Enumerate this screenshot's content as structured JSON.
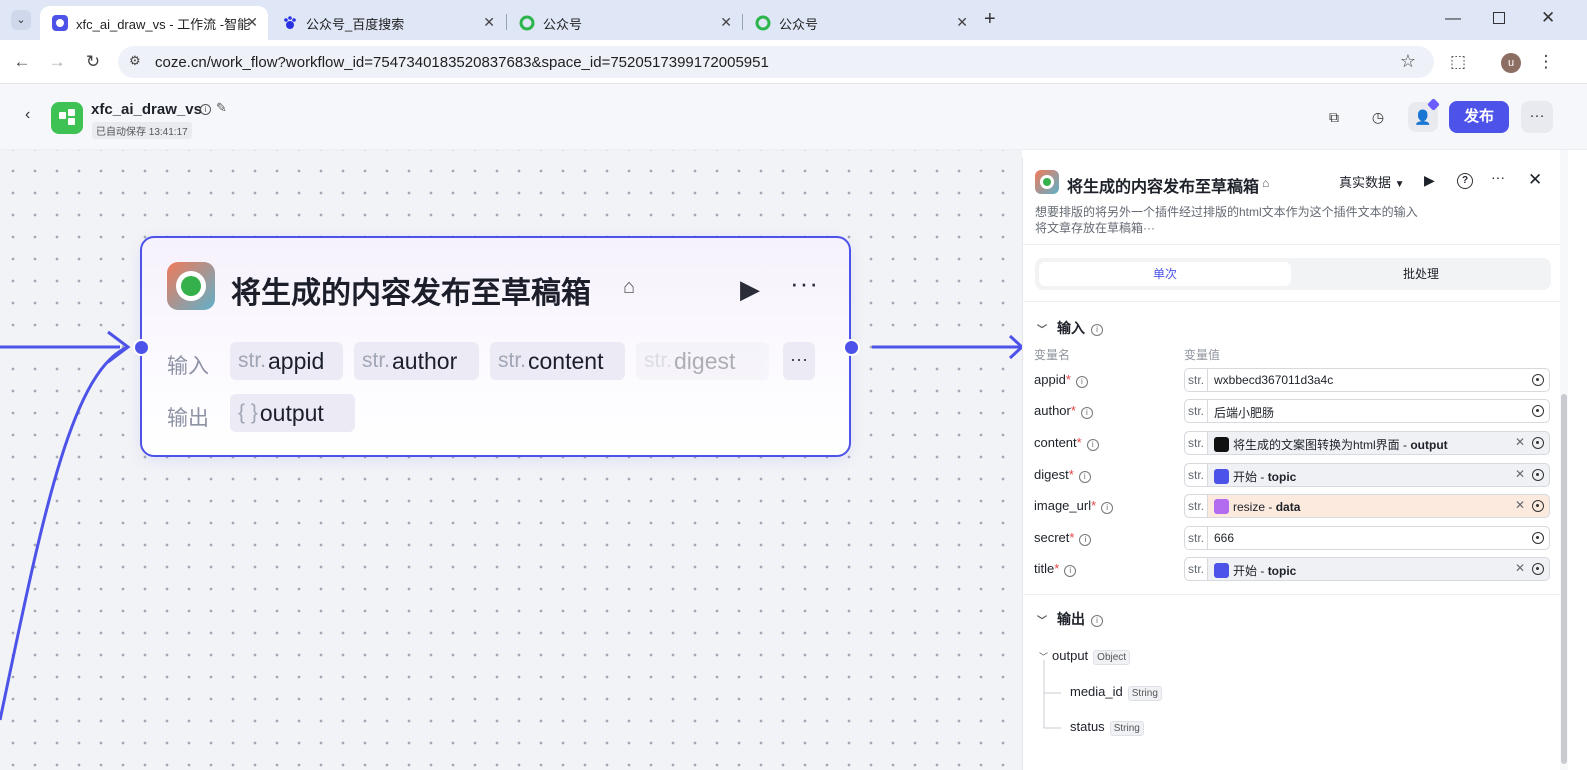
{
  "browser": {
    "tabs": [
      {
        "title": "xfc_ai_draw_vs - 工作流 -智能",
        "active": true
      },
      {
        "title": "公众号_百度搜索",
        "active": false
      },
      {
        "title": "公众号",
        "active": false
      },
      {
        "title": "公众号",
        "active": false
      }
    ],
    "url": "coze.cn/work_flow?workflow_id=7547340183520837683&space_id=7520517399172005951",
    "profile_initial": "u",
    "new_tab": "+"
  },
  "app": {
    "title": "xfc_ai_draw_vs",
    "autosave": "已自动保存 13:41:17",
    "publish_label": "发布",
    "more_label": "···"
  },
  "node": {
    "title": "将生成的内容发布至草稿箱",
    "input_label": "输入",
    "output_label": "输出",
    "type_prefix": "str.",
    "obj_prefix": "{ }",
    "more_label": "···",
    "inputs": [
      "appid",
      "author",
      "content",
      "digest"
    ],
    "output": "output"
  },
  "panel": {
    "title": "将生成的内容发布至草稿箱",
    "description_line1": "想要排版的将另外一个插件经过排版的html文本作为这个插件文本的输入",
    "description_line2": "将文章存放在草稿箱···",
    "data_mode": "真实数据",
    "seg_single": "单次",
    "seg_batch": "批处理",
    "input_section": "输入",
    "output_section": "输出",
    "col_var_name": "变量名",
    "col_var_value": "变量值",
    "type_prefix": "str.",
    "params": [
      {
        "name": "appid",
        "value": "wxbbecd367011d3a4c"
      },
      {
        "name": "author",
        "value": "后端小肥肠"
      },
      {
        "name": "content",
        "ref_node": "将生成的文案图转换为html界面",
        "sep": " - ",
        "ref_field": "output"
      },
      {
        "name": "digest",
        "ref_node": "开始",
        "sep": " - ",
        "ref_field": "topic"
      },
      {
        "name": "image_url",
        "ref_node": "resize",
        "sep": " - ",
        "ref_field": "data"
      },
      {
        "name": "secret",
        "value": "666"
      },
      {
        "name": "title",
        "ref_node": "开始",
        "sep": " - ",
        "ref_field": "topic"
      }
    ],
    "outputs": {
      "root": "output",
      "root_type": "Object",
      "children": [
        {
          "name": "media_id",
          "type": "String"
        },
        {
          "name": "status",
          "type": "String"
        }
      ]
    }
  },
  "colors": {
    "accent": "#4d53e8",
    "required": "#e54545",
    "canvas": "#f2f3f6"
  }
}
